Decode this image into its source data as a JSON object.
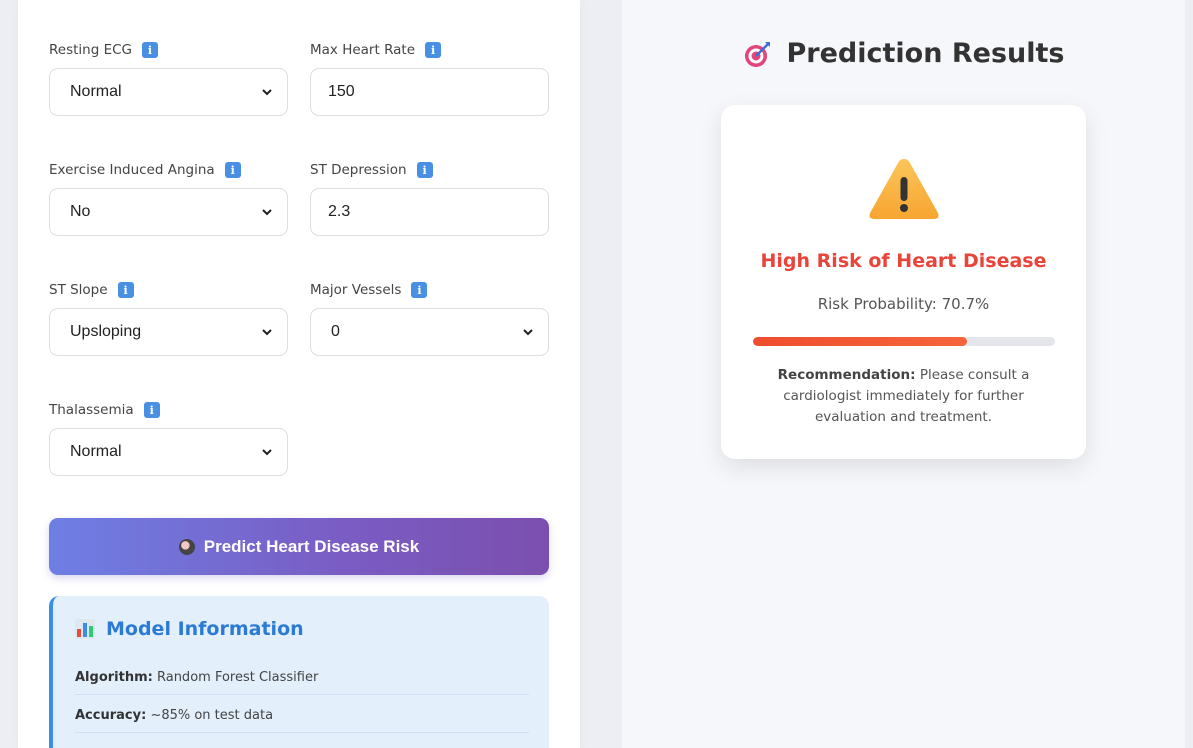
{
  "form": {
    "fields": [
      {
        "label": "Resting ECG",
        "value": "Normal",
        "type": "select"
      },
      {
        "label": "Max Heart Rate",
        "value": "150",
        "type": "input"
      },
      {
        "label": "Exercise Induced Angina",
        "value": "No",
        "type": "select"
      },
      {
        "label": "ST Depression",
        "value": "2.3",
        "type": "input"
      },
      {
        "label": "ST Slope",
        "value": "Upsloping",
        "type": "select"
      },
      {
        "label": "Major Vessels",
        "value": "0",
        "type": "select"
      },
      {
        "label": "Thalassemia",
        "value": "Normal",
        "type": "select"
      }
    ],
    "predict_label": "Predict Heart Disease Risk"
  },
  "model_info": {
    "title": "Model Information",
    "rows": [
      {
        "key": "Algorithm:",
        "value": "Random Forest Classifier"
      },
      {
        "key": "Accuracy:",
        "value": "~85% on test data"
      }
    ]
  },
  "results": {
    "title": "Prediction Results",
    "risk_label": "High Risk of Heart Disease",
    "probability_text": "Risk Probability: 70.7%",
    "probability_value": 0.707,
    "recommendation_key": "Recommendation:",
    "recommendation_text": "Please consult a cardiologist immediately for further evaluation and treatment."
  },
  "colors": {
    "accent": "#2b7bd5",
    "danger": "#e8443a",
    "button_gradient_start": "#6e7fe4",
    "button_gradient_end": "#7b4fae"
  }
}
